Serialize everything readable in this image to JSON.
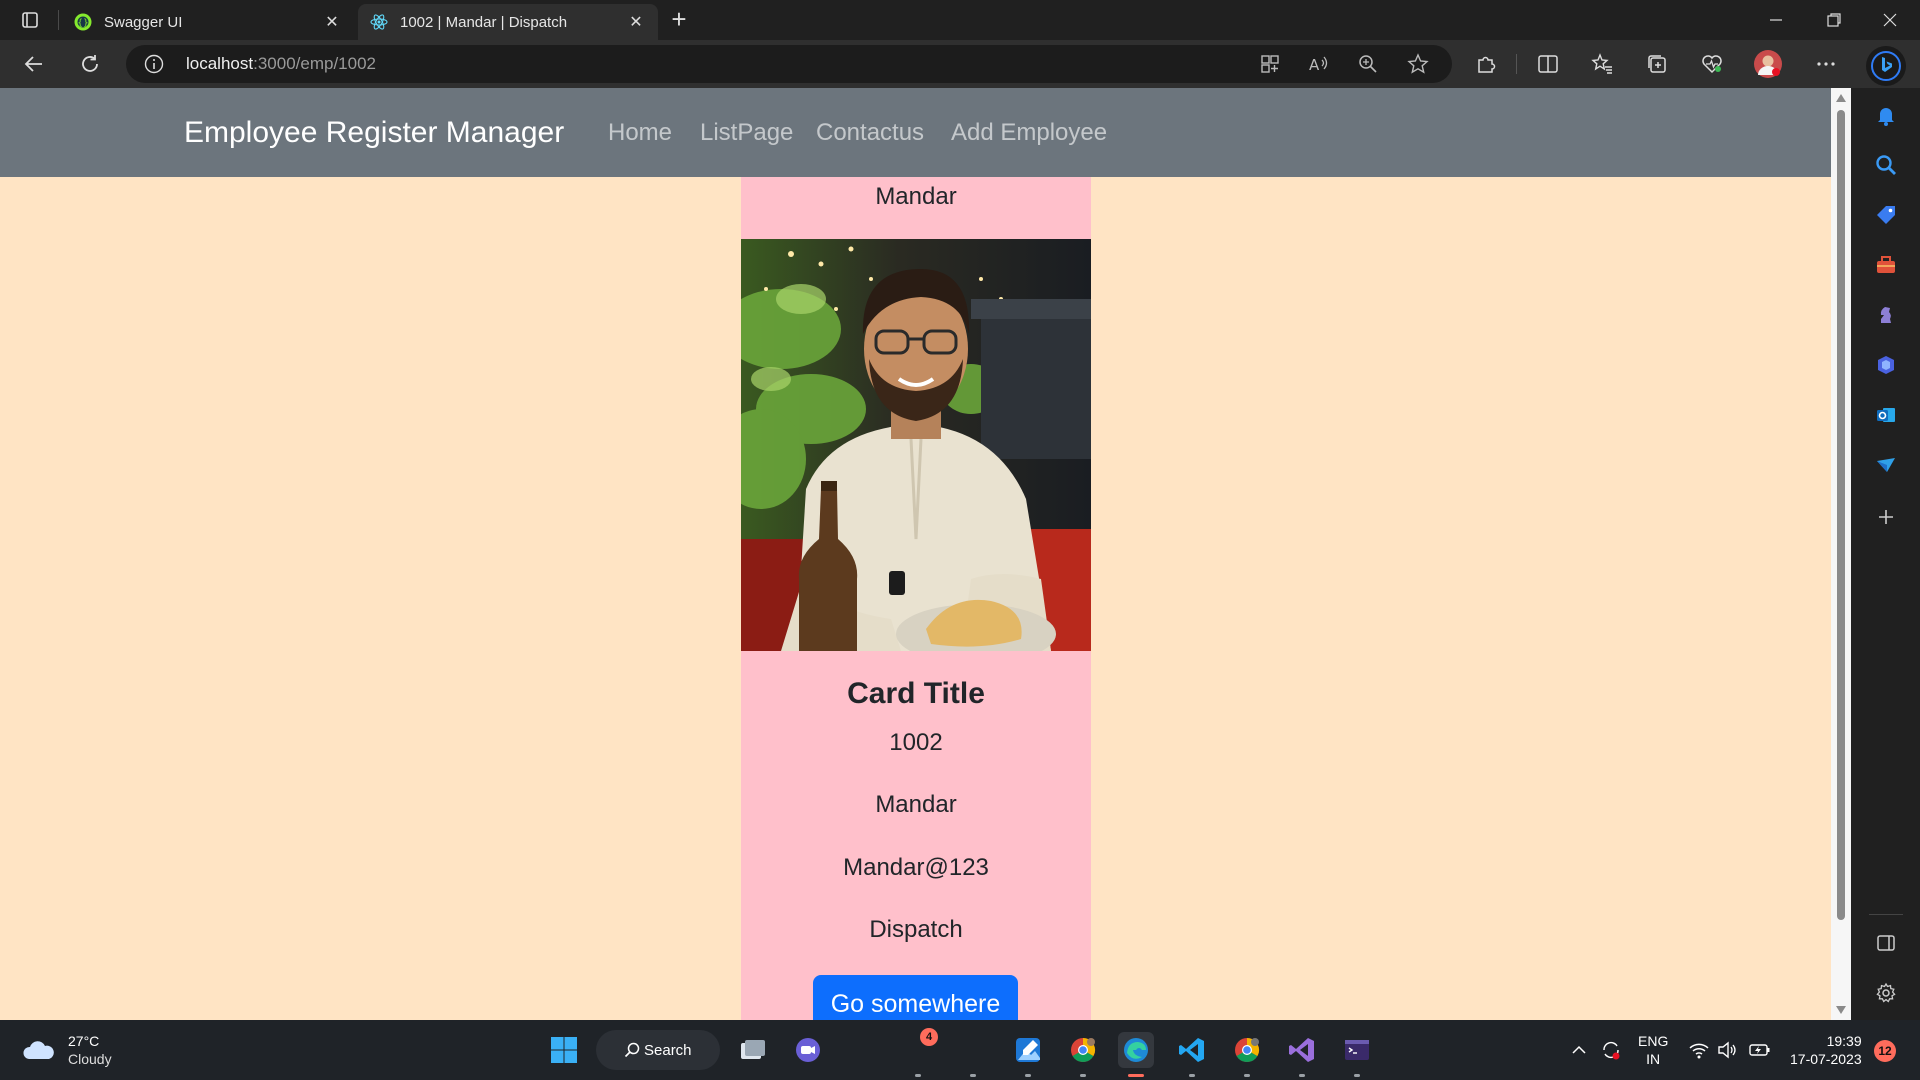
{
  "browser": {
    "tabs": [
      {
        "title": "Swagger UI",
        "active": false
      },
      {
        "title": "1002 | Mandar | Dispatch",
        "active": true
      }
    ],
    "address": {
      "host": "localhost",
      "path": ":3000/emp/1002"
    },
    "accent": "#0d6efd"
  },
  "navbar": {
    "brand": "Employee Register Manager",
    "links": [
      "Home",
      "ListPage",
      "Contactus",
      "Add Employee"
    ]
  },
  "card": {
    "header": "Mandar",
    "title": "Card Title",
    "lines": [
      "1002",
      "Mandar",
      "Mandar@123",
      "Dispatch"
    ],
    "button": "Go somewhere"
  },
  "colors": {
    "page_bg": "#ffe4c4",
    "card_bg": "#ffc0cb",
    "navbar_bg": "#6c757d",
    "button_bg": "#0d6efd"
  },
  "taskbar": {
    "weather": {
      "temp": "27°C",
      "condition": "Cloudy"
    },
    "search_label": "Search",
    "app_badge": "4",
    "language": {
      "top": "ENG",
      "bottom": "IN"
    },
    "clock": {
      "time": "19:39",
      "date": "17-07-2023"
    },
    "notifications": "12"
  }
}
